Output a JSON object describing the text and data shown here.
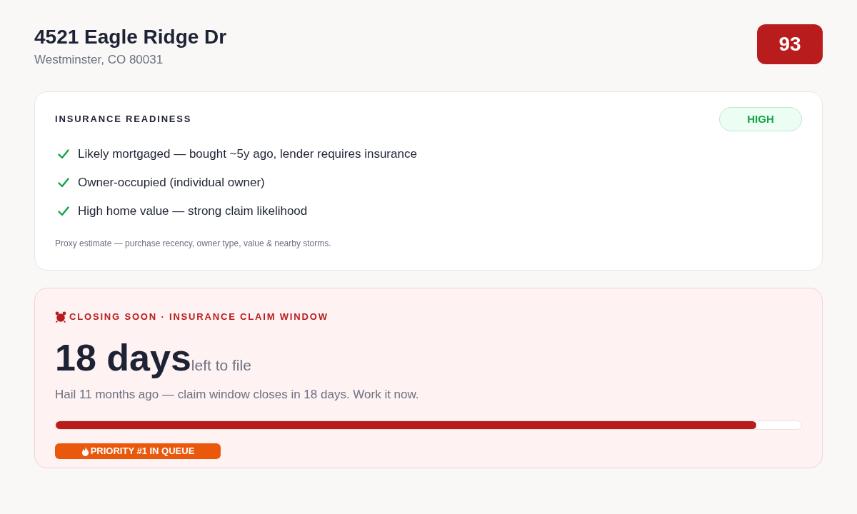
{
  "property": {
    "address": "4521 Eagle Ridge Dr",
    "locality": "Westminster, CO 80031",
    "score": "93"
  },
  "insurance_readiness": {
    "title": "INSURANCE READINESS",
    "rating": "HIGH",
    "factors": [
      {
        "text": "Likely mortgaged — bought ~5y ago, lender requires insurance",
        "checked": true
      },
      {
        "text": "Owner-occupied (individual owner)",
        "checked": true
      },
      {
        "text": "High home value — strong claim likelihood",
        "checked": true
      }
    ],
    "note": "Proxy estimate — purchase recency, owner type, value & nearby storms."
  },
  "claim_window": {
    "label": "CLOSING SOON · INSURANCE CLAIM WINDOW",
    "days": "18 days",
    "days_suffix": "left to file",
    "summary": "Hail 11 months ago — claim window closes in 18 days. Work it now.",
    "progress": {
      "level": 0.94
    },
    "priority": "PRIORITY #1 IN QUEUE"
  }
}
